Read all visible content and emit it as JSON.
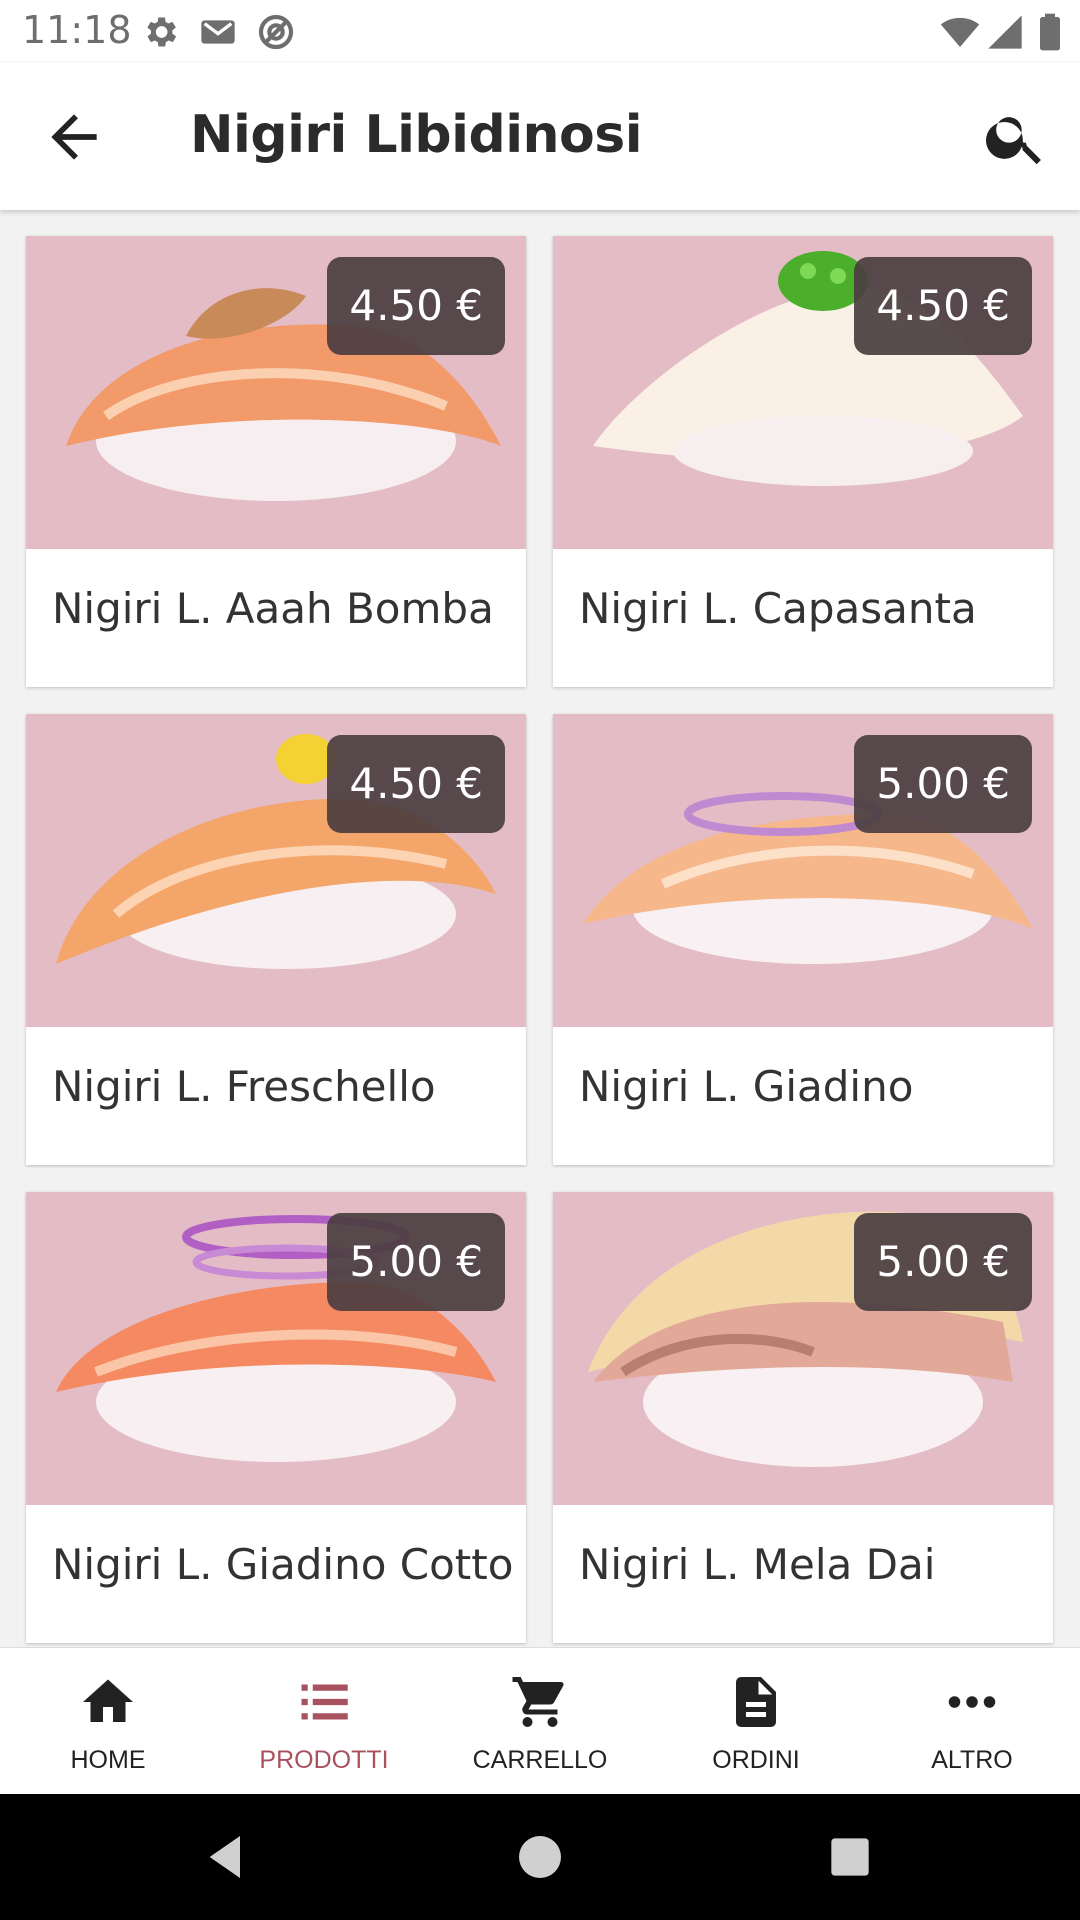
{
  "status_bar": {
    "time": "11:18",
    "icons": [
      "gear-icon",
      "gmail-icon",
      "at-sign-icon",
      "wifi-icon",
      "signal-icon",
      "battery-icon"
    ]
  },
  "app_bar": {
    "title": "Nigiri Libidinosi",
    "back_icon": "arrow-back-icon",
    "search_icon": "search-icon"
  },
  "products": [
    {
      "name": "Nigiri L. Aaah Bomba",
      "price": "4.50 €"
    },
    {
      "name": "Nigiri L. Capasanta",
      "price": "4.50 €"
    },
    {
      "name": "Nigiri L. Freschello",
      "price": "4.50 €"
    },
    {
      "name": "Nigiri L. Giadino",
      "price": "5.00 €"
    },
    {
      "name": "Nigiri L. Giadino Cotto",
      "price": "5.00 €"
    },
    {
      "name": "Nigiri L. Mela Dai",
      "price": "5.00 €"
    }
  ],
  "bottom_nav": {
    "items": [
      {
        "label": "HOME",
        "icon": "home-icon"
      },
      {
        "label": "PRODOTTI",
        "icon": "list-icon",
        "active": true
      },
      {
        "label": "CARRELLO",
        "icon": "cart-icon"
      },
      {
        "label": "ORDINI",
        "icon": "document-icon"
      },
      {
        "label": "ALTRO",
        "icon": "more-icon"
      }
    ]
  },
  "colors": {
    "accent": "#a8525f",
    "image_bg": "#e4bcc6",
    "price_badge": "#4b3e40"
  }
}
